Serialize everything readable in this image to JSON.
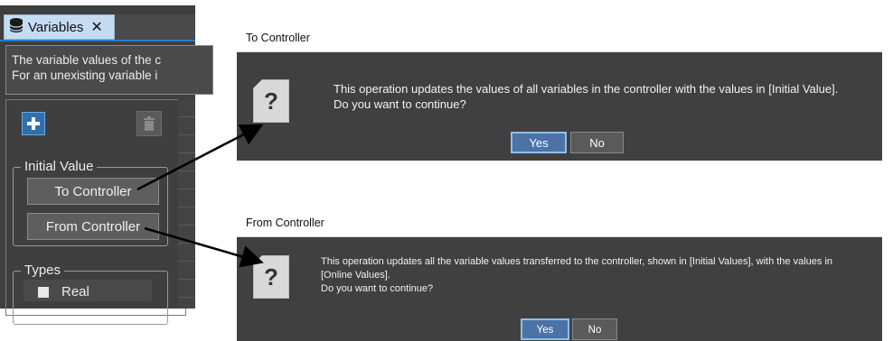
{
  "variables_panel": {
    "tab_label": "Variables",
    "tab_close": "✕",
    "description_lines": [
      "The variable values of the c",
      "For an unexisting variable i"
    ],
    "initial_value_group": {
      "legend": "Initial Value",
      "to_controller_button": "To Controller",
      "from_controller_button": "From Controller"
    },
    "types_group": {
      "legend": "Types",
      "items": [
        "Real"
      ]
    }
  },
  "dialogs": {
    "to_controller": {
      "title": "To Controller",
      "icon": "question-icon",
      "icon_glyph": "?",
      "message_lines": [
        "This operation updates the values of all variables in the controller with the values in [Initial Value].",
        "Do you want to continue?"
      ],
      "yes_label": "Yes",
      "no_label": "No"
    },
    "from_controller": {
      "title": "From Controller",
      "icon": "question-icon",
      "icon_glyph": "?",
      "message_lines": [
        "This operation updates all the variable values transferred to the controller, shown in [Initial Values], with the values in",
        "[Online Values].",
        "Do you want to continue?"
      ],
      "yes_label": "Yes",
      "no_label": "No"
    }
  },
  "colors": {
    "panel_bg": "#3f3f3f",
    "tab_active": "#c4dcf3",
    "dialog_bg": "#404040",
    "primary_button": "#4b73a6",
    "arrow": "#000000"
  }
}
